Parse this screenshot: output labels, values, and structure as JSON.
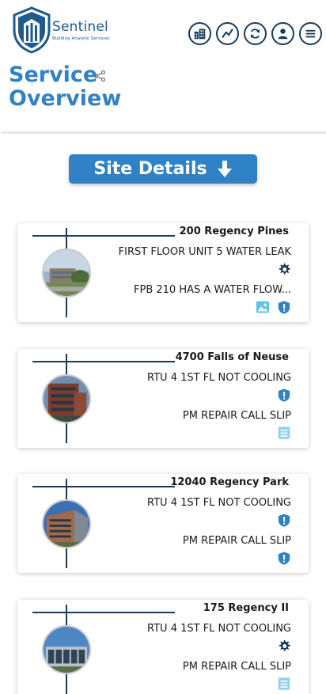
{
  "brand": {
    "name": "Sentinel",
    "tagline": "Building Analytic Services",
    "primary_color": "#2f82c5",
    "dark_color": "#1a3a5c",
    "logo_icon": "shield-building-icon"
  },
  "nav": [
    {
      "icon": "buildings-icon",
      "label": "Buildings"
    },
    {
      "icon": "analytics-icon",
      "label": "Analytics"
    },
    {
      "icon": "sync-icon",
      "label": "Refresh"
    },
    {
      "icon": "user-icon",
      "label": "Profile"
    },
    {
      "icon": "menu-icon",
      "label": "Menu"
    }
  ],
  "page": {
    "title": "Service Overview",
    "share_icon": "share-icon"
  },
  "site_button": {
    "label": "Site Details",
    "icon": "arrow-down-icon"
  },
  "sites": [
    {
      "address": "200  Regency Pines",
      "item1": "FIRST FLOOR UNIT 5 WATER LEAK",
      "item1_icon": "gear-icon",
      "item2": "FPB 210 HAS A WATER FLOW...",
      "item2_icons": [
        "image-icon",
        "alert-shield-icon"
      ]
    },
    {
      "address": "4700 Falls of Neuse",
      "item1": "RTU 4 1ST FL NOT COOLING",
      "item1_icon": "alert-shield-icon",
      "item2": "PM REPAIR CALL SLIP",
      "item2_icons": [
        "receipt-icon"
      ]
    },
    {
      "address": "12040 Regency Park",
      "item1": "RTU 4 1ST FL NOT COOLING",
      "item1_icon": "alert-shield-icon",
      "item2": "PM REPAIR CALL SLIP",
      "item2_icons": [
        "alert-shield-icon"
      ]
    },
    {
      "address": "175 Regency II",
      "item1": "RTU 4 1ST FL NOT COOLING",
      "item1_icon": "gear-icon",
      "item2": "PM REPAIR CALL SLIP",
      "item2_icons": [
        "receipt-icon"
      ]
    }
  ]
}
